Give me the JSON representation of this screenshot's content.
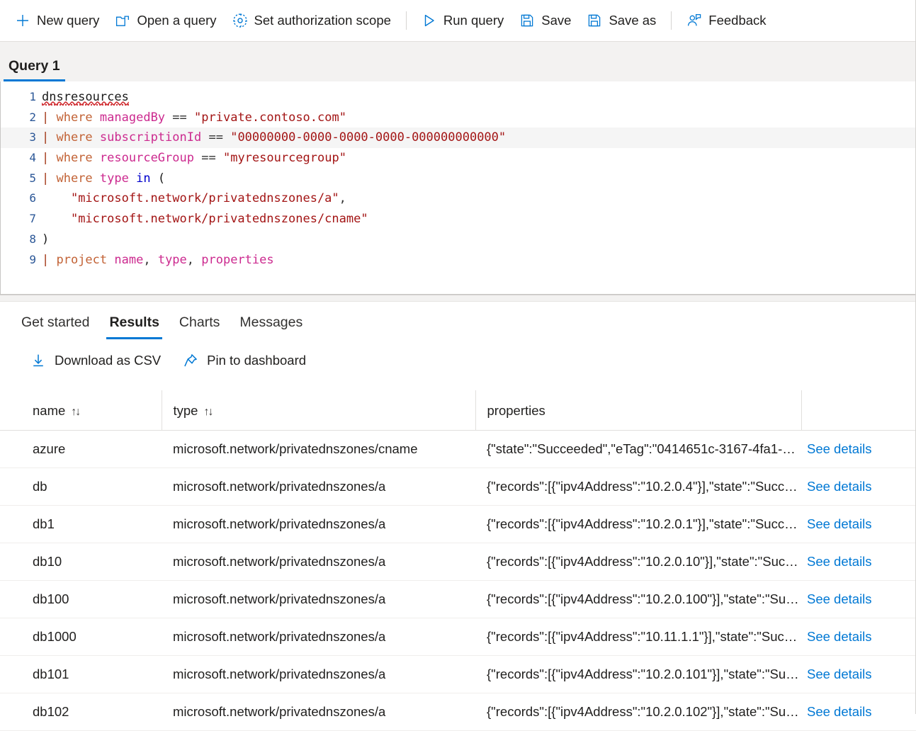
{
  "toolbar": {
    "items": [
      {
        "id": "new-query",
        "label": "New query",
        "icon": "plus-icon"
      },
      {
        "id": "open-query",
        "label": "Open a query",
        "icon": "folder-open-icon"
      },
      {
        "id": "auth-scope",
        "label": "Set authorization scope",
        "icon": "gear-icon"
      },
      {
        "id": "run-query",
        "label": "Run query",
        "icon": "play-icon"
      },
      {
        "id": "save",
        "label": "Save",
        "icon": "save-icon"
      },
      {
        "id": "save-as",
        "label": "Save as",
        "icon": "save-as-icon"
      },
      {
        "id": "feedback",
        "label": "Feedback",
        "icon": "feedback-person-icon"
      }
    ]
  },
  "query_tab": {
    "label": "Query 1"
  },
  "editor": {
    "current_line": 3,
    "lines": [
      {
        "n": "1",
        "segments": [
          {
            "t": "dnsresources",
            "c": "plain squiggle"
          }
        ]
      },
      {
        "n": "2",
        "segments": [
          {
            "t": "| ",
            "c": "pipe"
          },
          {
            "t": "where",
            "c": "kw"
          },
          {
            "t": " ",
            "c": "plain"
          },
          {
            "t": "managedBy",
            "c": "col"
          },
          {
            "t": " ",
            "c": "plain"
          },
          {
            "t": "==",
            "c": "op"
          },
          {
            "t": " ",
            "c": "plain"
          },
          {
            "t": "\"private.contoso.com\"",
            "c": "str"
          }
        ]
      },
      {
        "n": "3",
        "segments": [
          {
            "t": "| ",
            "c": "pipe"
          },
          {
            "t": "where",
            "c": "kw"
          },
          {
            "t": " ",
            "c": "plain"
          },
          {
            "t": "subscriptionId",
            "c": "col"
          },
          {
            "t": " ",
            "c": "plain"
          },
          {
            "t": "==",
            "c": "op"
          },
          {
            "t": " ",
            "c": "plain"
          },
          {
            "t": "\"00000000-0000-0000-0000-000000000000\"",
            "c": "str"
          }
        ]
      },
      {
        "n": "4",
        "segments": [
          {
            "t": "| ",
            "c": "pipe"
          },
          {
            "t": "where",
            "c": "kw"
          },
          {
            "t": " ",
            "c": "plain"
          },
          {
            "t": "resourceGroup",
            "c": "col"
          },
          {
            "t": " ",
            "c": "plain"
          },
          {
            "t": "==",
            "c": "op"
          },
          {
            "t": " ",
            "c": "plain"
          },
          {
            "t": "\"myresourcegroup\"",
            "c": "str"
          }
        ]
      },
      {
        "n": "5",
        "segments": [
          {
            "t": "| ",
            "c": "pipe"
          },
          {
            "t": "where",
            "c": "kw"
          },
          {
            "t": " ",
            "c": "plain"
          },
          {
            "t": "type",
            "c": "col"
          },
          {
            "t": " ",
            "c": "plain"
          },
          {
            "t": "in",
            "c": "inkw"
          },
          {
            "t": " ",
            "c": "plain"
          },
          {
            "t": "(",
            "c": "plain"
          }
        ]
      },
      {
        "n": "6",
        "segments": [
          {
            "t": "    ",
            "c": "plain"
          },
          {
            "t": "\"microsoft.network/privatednszones/a\"",
            "c": "str"
          },
          {
            "t": ",",
            "c": "op"
          }
        ]
      },
      {
        "n": "7",
        "segments": [
          {
            "t": "    ",
            "c": "plain"
          },
          {
            "t": "\"microsoft.network/privatednszones/cname\"",
            "c": "str"
          }
        ]
      },
      {
        "n": "8",
        "segments": [
          {
            "t": ")",
            "c": "plain"
          }
        ]
      },
      {
        "n": "9",
        "segments": [
          {
            "t": "| ",
            "c": "pipe"
          },
          {
            "t": "project",
            "c": "kw"
          },
          {
            "t": " ",
            "c": "plain"
          },
          {
            "t": "name",
            "c": "col"
          },
          {
            "t": ", ",
            "c": "op"
          },
          {
            "t": "type",
            "c": "col"
          },
          {
            "t": ", ",
            "c": "op"
          },
          {
            "t": "properties",
            "c": "col"
          }
        ]
      }
    ]
  },
  "results": {
    "tabs": [
      {
        "id": "get-started",
        "label": "Get started",
        "active": false
      },
      {
        "id": "results",
        "label": "Results",
        "active": true
      },
      {
        "id": "charts",
        "label": "Charts",
        "active": false
      },
      {
        "id": "messages",
        "label": "Messages",
        "active": false
      }
    ],
    "actions": [
      {
        "id": "download-csv",
        "label": "Download as CSV",
        "icon": "download-arrow-icon"
      },
      {
        "id": "pin-to-dashboard",
        "label": "Pin to dashboard",
        "icon": "pin-icon"
      }
    ],
    "columns": [
      {
        "id": "name",
        "label": "name",
        "sortable": true,
        "sort_glyph": "↑↓"
      },
      {
        "id": "type",
        "label": "type",
        "sortable": true,
        "sort_glyph": "↑↓"
      },
      {
        "id": "properties",
        "label": "properties",
        "sortable": false,
        "sort_glyph": ""
      },
      {
        "id": "details",
        "label": "",
        "sortable": false,
        "sort_glyph": ""
      }
    ],
    "details_link_label": "See details",
    "rows": [
      {
        "name": "azure",
        "type": "microsoft.network/privatednszones/cname",
        "properties": "{\"state\":\"Succeeded\",\"eTag\":\"0414651c-3167-4fa1-…",
        "details": "See details"
      },
      {
        "name": "db",
        "type": "microsoft.network/privatednszones/a",
        "properties": "{\"records\":[{\"ipv4Address\":\"10.2.0.4\"}],\"state\":\"Succ…",
        "details": "See details"
      },
      {
        "name": "db1",
        "type": "microsoft.network/privatednszones/a",
        "properties": "{\"records\":[{\"ipv4Address\":\"10.2.0.1\"}],\"state\":\"Succ…",
        "details": "See details"
      },
      {
        "name": "db10",
        "type": "microsoft.network/privatednszones/a",
        "properties": "{\"records\":[{\"ipv4Address\":\"10.2.0.10\"}],\"state\":\"Suc…",
        "details": "See details"
      },
      {
        "name": "db100",
        "type": "microsoft.network/privatednszones/a",
        "properties": "{\"records\":[{\"ipv4Address\":\"10.2.0.100\"}],\"state\":\"Su…",
        "details": "See details"
      },
      {
        "name": "db1000",
        "type": "microsoft.network/privatednszones/a",
        "properties": "{\"records\":[{\"ipv4Address\":\"10.11.1.1\"}],\"state\":\"Suc…",
        "details": "See details"
      },
      {
        "name": "db101",
        "type": "microsoft.network/privatednszones/a",
        "properties": "{\"records\":[{\"ipv4Address\":\"10.2.0.101\"}],\"state\":\"Su…",
        "details": "See details"
      },
      {
        "name": "db102",
        "type": "microsoft.network/privatednszones/a",
        "properties": "{\"records\":[{\"ipv4Address\":\"10.2.0.102\"}],\"state\":\"Su…",
        "details": "See details"
      }
    ]
  },
  "colors": {
    "accent": "#0078d4",
    "link": "#0078d4",
    "text": "#201f1e",
    "tabstrip_bg": "#f3f2f1",
    "border": "#e1dfdd"
  }
}
